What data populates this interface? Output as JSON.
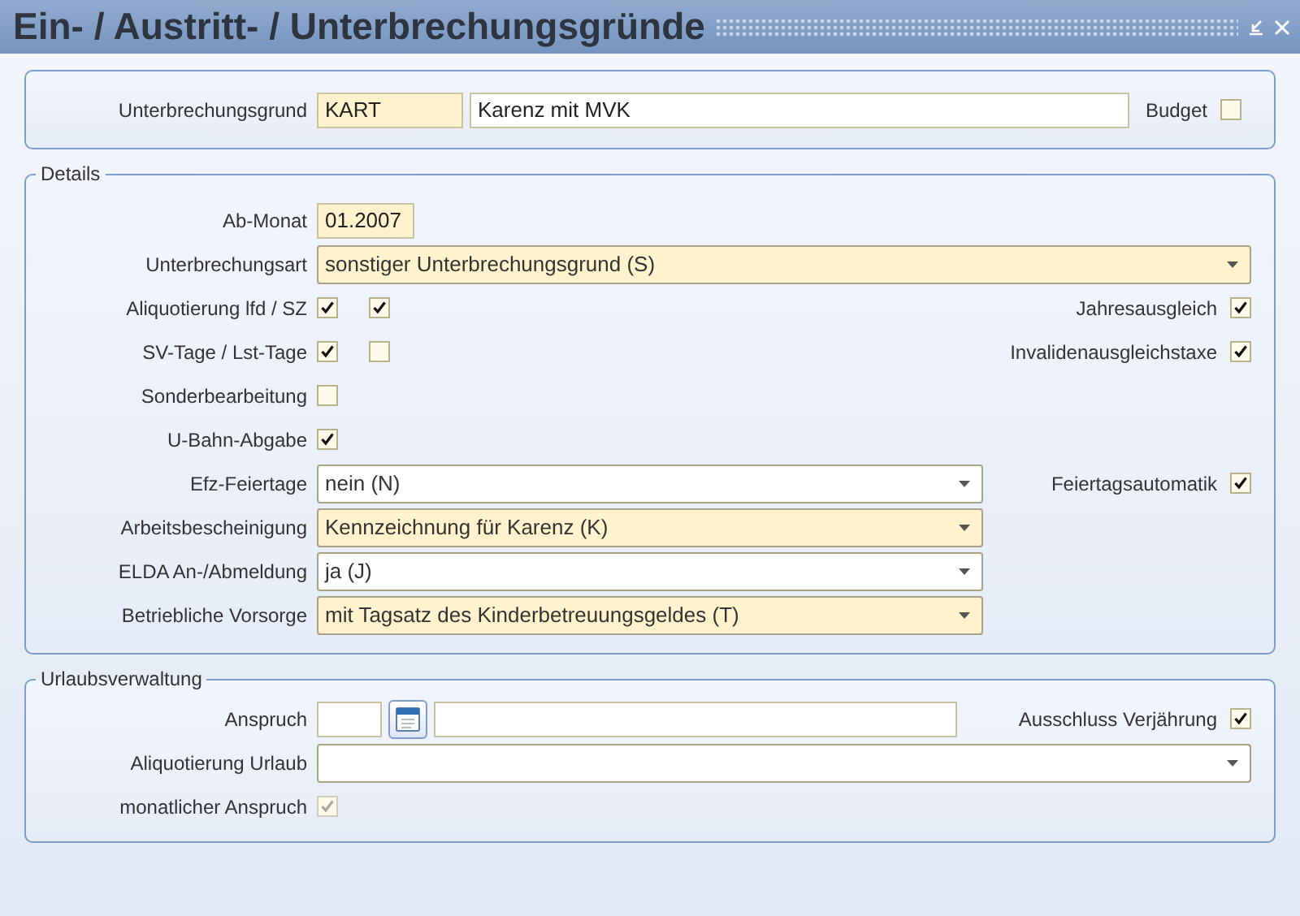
{
  "window": {
    "title": "Ein- / Austritt- / Unterbrechungsgründe"
  },
  "header": {
    "label": "Unterbrechungsgrund",
    "code": "KART",
    "description": "Karenz mit MVK",
    "budget": {
      "label": "Budget",
      "checked": false
    }
  },
  "details": {
    "legend": "Details",
    "rows": [
      {
        "kind": "input",
        "label": "Ab-Monat",
        "value": "01.2007",
        "required": true
      },
      {
        "kind": "select",
        "label": "Unterbrechungsart",
        "value": "sonstiger Unterbrechungsgrund (S)",
        "required": true,
        "wide": true
      },
      {
        "kind": "checks",
        "label": "Aliquotierung lfd / SZ",
        "checks": [
          {
            "checked": true,
            "disabled": false
          },
          {
            "checked": true,
            "disabled": false
          }
        ],
        "side": {
          "label": "Jahresausgleich",
          "checked": true
        }
      },
      {
        "kind": "checks",
        "label": "SV-Tage / Lst-Tage",
        "checks": [
          {
            "checked": true,
            "disabled": false
          },
          {
            "checked": false,
            "disabled": false
          }
        ],
        "side": {
          "label": "Invalidenausgleichstaxe",
          "checked": true
        }
      },
      {
        "kind": "checks",
        "label": "Sonderbearbeitung",
        "checks": [
          {
            "checked": false,
            "disabled": false
          }
        ]
      },
      {
        "kind": "checks",
        "label": "U-Bahn-Abgabe",
        "checks": [
          {
            "checked": true,
            "disabled": false
          }
        ]
      },
      {
        "kind": "select",
        "label": "Efz-Feiertage",
        "value": "nein (N)",
        "required": false,
        "wide": false,
        "side": {
          "label": "Feiertagsautomatik",
          "checked": true
        }
      },
      {
        "kind": "select",
        "label": "Arbeitsbescheinigung",
        "value": "Kennzeichnung für Karenz (K)",
        "required": true,
        "wide": false
      },
      {
        "kind": "select",
        "label": "ELDA An-/Abmeldung",
        "value": "ja (J)",
        "required": false,
        "wide": false
      },
      {
        "kind": "select",
        "label": "Betriebliche Vorsorge",
        "value": "mit Tagsatz des Kinderbetreuungsgeldes (T)",
        "required": true,
        "wide": false
      }
    ]
  },
  "vacation": {
    "legend": "Urlaubsverwaltung",
    "rows": [
      {
        "kind": "calendar",
        "label": "Anspruch",
        "side": {
          "label": "Ausschluss Verjährung",
          "checked": true
        }
      },
      {
        "kind": "select",
        "label": "Aliquotierung Urlaub",
        "required": false,
        "wide": true
      },
      {
        "kind": "checks",
        "label": "monatlicher Anspruch",
        "checks": [
          {
            "checked": true,
            "disabled": true
          }
        ]
      }
    ]
  }
}
